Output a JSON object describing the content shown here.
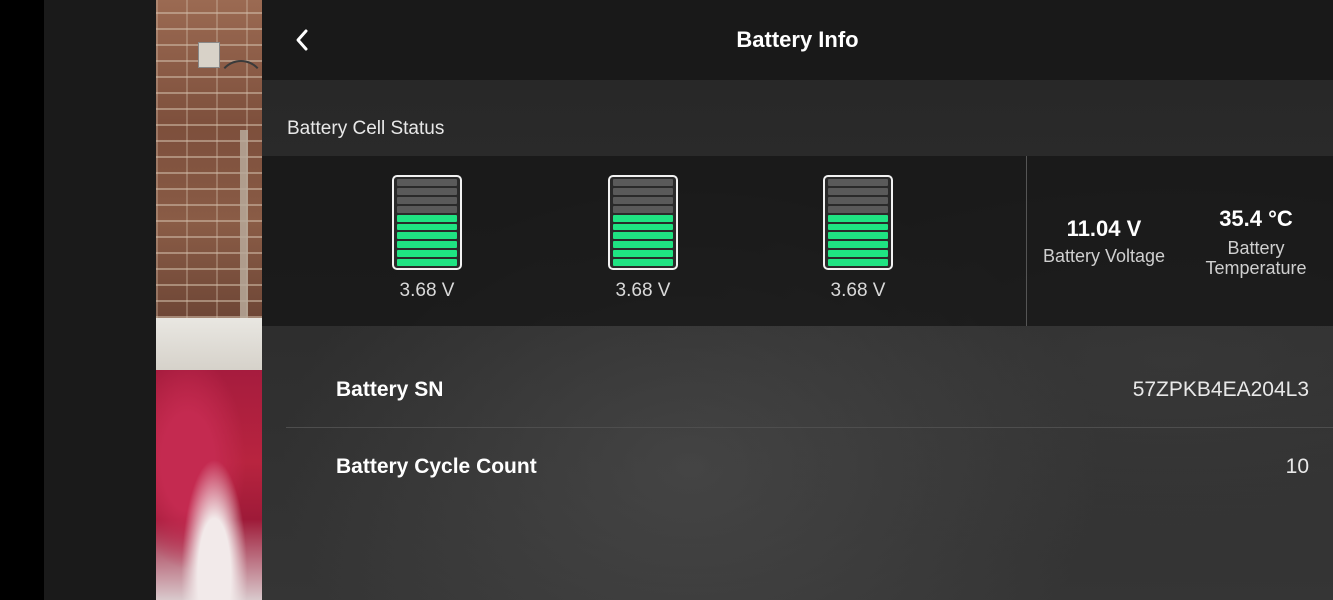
{
  "header": {
    "title": "Battery Info",
    "back_icon": "chevron-left-icon"
  },
  "cell_status": {
    "section_title": "Battery Cell Status",
    "cells": [
      {
        "voltage": "3.68 V",
        "level_fraction": 0.6
      },
      {
        "voltage": "3.68 V",
        "level_fraction": 0.6
      },
      {
        "voltage": "3.68 V",
        "level_fraction": 0.6
      }
    ],
    "battery_voltage": {
      "value": "11.04 V",
      "label": "Battery Voltage"
    },
    "battery_temperature": {
      "value": "35.4 °C",
      "label": "Battery\nTemperature"
    }
  },
  "info": {
    "rows": [
      {
        "label": "Battery SN",
        "value": "57ZPKB4EA204L3"
      },
      {
        "label": "Battery Cycle Count",
        "value": "10"
      }
    ]
  },
  "colors": {
    "cell_fill": "#1fe382",
    "cell_empty": "#5a5a5a",
    "header_bg": "#181818",
    "text_primary": "#ffffff"
  }
}
